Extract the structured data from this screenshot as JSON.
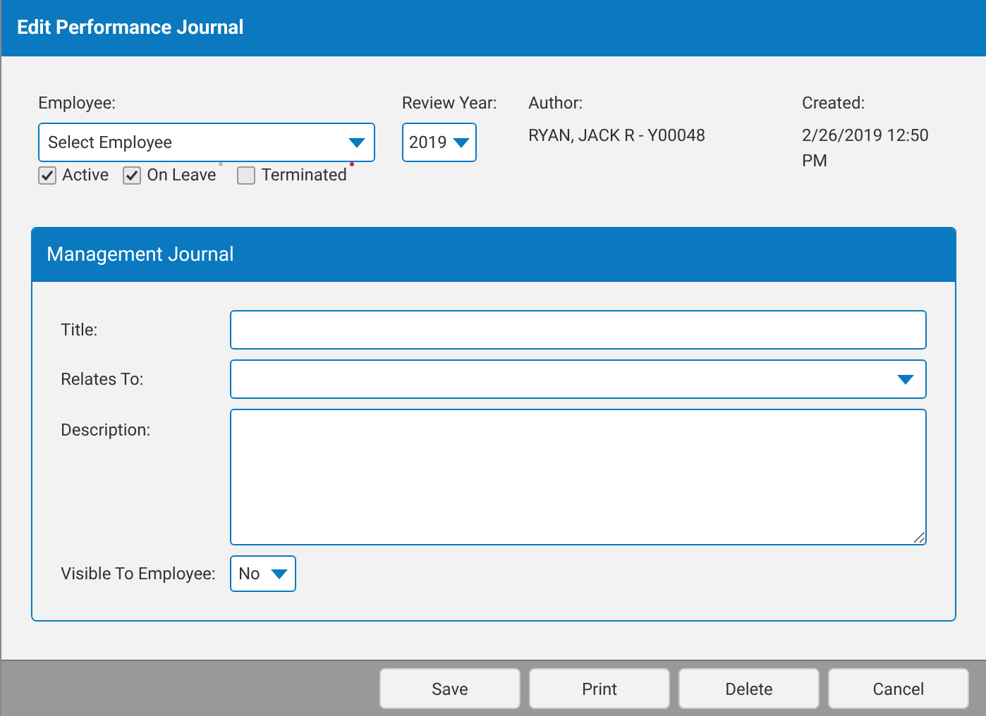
{
  "window": {
    "title": "Edit Performance Journal"
  },
  "employee": {
    "label": "Employee:",
    "value": "Select Employee"
  },
  "review_year": {
    "label": "Review Year:",
    "value": "2019"
  },
  "author": {
    "label": "Author:",
    "value": "RYAN, JACK R - Y00048"
  },
  "created": {
    "label": "Created:",
    "value": "2/26/2019 12:50 PM"
  },
  "filters": [
    {
      "label": "Active",
      "checked": true
    },
    {
      "label": "On Leave",
      "checked": true,
      "color": "#bbbbbb"
    },
    {
      "label": "Terminated",
      "checked": false,
      "color": "#e02020"
    }
  ],
  "panel": {
    "title": "Management Journal",
    "fields": [
      {
        "kind": "text",
        "label": "Title:"
      },
      {
        "kind": "select",
        "label": "Relates To:"
      },
      {
        "kind": "textarea",
        "label": "Description:"
      },
      {
        "kind": "small-select",
        "label": "Visible To Employee:",
        "value": "No"
      }
    ]
  },
  "buttons": [
    "Save",
    "Print",
    "Delete",
    "Cancel"
  ]
}
